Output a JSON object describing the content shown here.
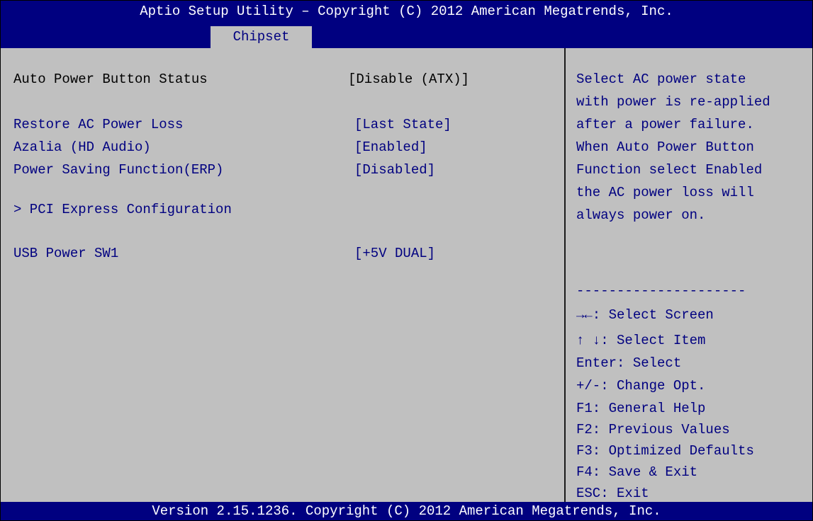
{
  "header": {
    "title": "Aptio Setup Utility – Copyright (C) 2012 American Megatrends, Inc.",
    "tab": "Chipset"
  },
  "settings": [
    {
      "label": "Auto Power Button Status",
      "value": "[Disable (ATX)]"
    },
    {
      "label": "Restore AC Power Loss",
      "value": "[Last State]"
    },
    {
      "label": "Azalia (HD Audio)",
      "value": "[Enabled]"
    },
    {
      "label": "Power Saving Function(ERP)",
      "value": "[Disabled]"
    },
    {
      "label": "> PCI Express Configuration",
      "value": ""
    },
    {
      "label": "USB Power SW1",
      "value": "[+5V DUAL]"
    }
  ],
  "help_text": [
    "Select AC power state",
    "with power is re-applied",
    "after a power failure.",
    "When Auto Power Button",
    "Function select Enabled",
    "the AC power loss will",
    "always power on."
  ],
  "separator": "---------------------",
  "keys": [
    "→←: Select Screen",
    "↑ ↓: Select Item",
    "Enter: Select",
    "+/-:  Change Opt.",
    "F1:   General Help",
    "F2:   Previous Values",
    "F3:   Optimized Defaults",
    "F4:   Save & Exit",
    "ESC: Exit"
  ],
  "footer": "Version 2.15.1236. Copyright (C) 2012 American Megatrends, Inc.",
  "colors": {
    "header_bg": "#000080",
    "body_bg": "#c0c0c0",
    "text_blue": "#000080",
    "text_white": "#ffffff"
  }
}
